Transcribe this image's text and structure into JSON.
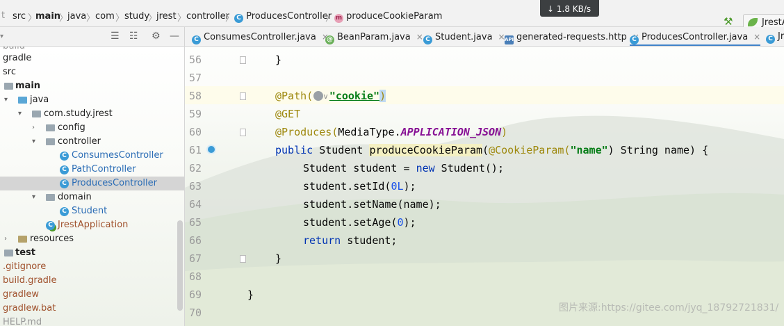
{
  "breadcrumb": {
    "items": [
      "src",
      "main",
      "java",
      "com",
      "study",
      "jrest",
      "controller",
      "ProducesController",
      "produceCookieParam"
    ]
  },
  "network_speed": "↓ 1.8 KB/s",
  "run_config": "JrestA",
  "tabs": [
    {
      "label": "ConsumesController.java",
      "icon": "class-icon"
    },
    {
      "label": "BeanParam.java",
      "icon": "annotation-icon"
    },
    {
      "label": "Student.java",
      "icon": "class-icon"
    },
    {
      "label": "generated-requests.http",
      "icon": "api-icon"
    },
    {
      "label": "ProducesController.java",
      "icon": "class-icon",
      "active": true
    },
    {
      "label": "Jr",
      "icon": "class-icon"
    }
  ],
  "tree": [
    {
      "label": "gradle"
    },
    {
      "label": "src"
    },
    {
      "label": "main"
    },
    {
      "label": "java"
    },
    {
      "label": "com.study.jrest"
    },
    {
      "label": "config"
    },
    {
      "label": "controller"
    },
    {
      "label": "ConsumesController"
    },
    {
      "label": "PathController"
    },
    {
      "label": "ProducesController",
      "selected": true
    },
    {
      "label": "domain"
    },
    {
      "label": "Student"
    },
    {
      "label": "JrestApplication"
    },
    {
      "label": "resources"
    },
    {
      "label": "test"
    },
    {
      "label": ".gitignore"
    },
    {
      "label": "build.gradle"
    },
    {
      "label": "gradlew"
    },
    {
      "label": "gradlew.bat"
    }
  ],
  "editor": {
    "line_numbers": [
      "56",
      "57",
      "58",
      "59",
      "60",
      "61",
      "62",
      "63",
      "64",
      "65",
      "66",
      "67",
      "68",
      "69",
      "70"
    ],
    "code": {
      "l56": "}",
      "l58_anno": "@Path(",
      "l58_str": "\"cookie\"",
      "l58_close": ")",
      "l59": "@GET",
      "l60_anno": "@Produces(",
      "l60_type": "MediaType.",
      "l60_const": "APPLICATION_JSON",
      "l60_close": ")",
      "l61_kw": "public",
      "l61_type": " Student ",
      "l61_method": "produceCookieParam",
      "l61_open": "(",
      "l61_anno": "@CookieParam(",
      "l61_str": "\"name\"",
      "l61_rest": ") String name) {",
      "l62_a": "Student student = ",
      "l62_kw": "new",
      "l62_b": " Student();",
      "l63_a": "student.setId(",
      "l63_num": "0L",
      "l63_b": ");",
      "l64": "student.setName(name);",
      "l65_a": "student.setAge(",
      "l65_num": "0",
      "l65_b": ");",
      "l66_kw": "return",
      "l66_b": " student;",
      "l67": "}",
      "l69": "}"
    }
  },
  "watermark": "图片来源:https://gitee.com/jyq_18792721831/"
}
